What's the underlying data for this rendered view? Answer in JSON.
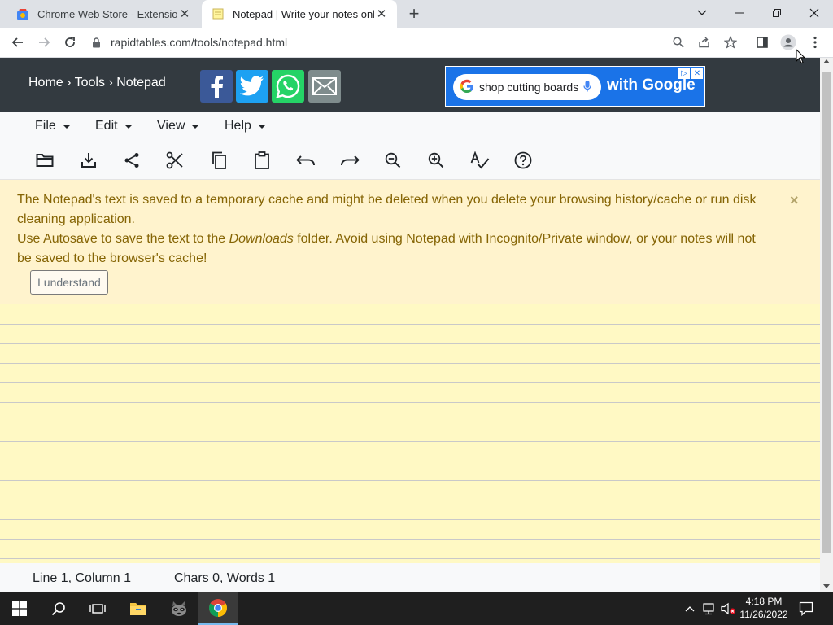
{
  "browser": {
    "tabs": [
      {
        "title": "Chrome Web Store - Extensions",
        "active": false
      },
      {
        "title": "Notepad | Write your notes online",
        "active": true
      }
    ],
    "url": "rapidtables.com/tools/notepad.html"
  },
  "header": {
    "breadcrumb": [
      "Home",
      "Tools",
      "Notepad"
    ],
    "breadcrumb_sep": "›",
    "share": [
      "facebook-icon",
      "twitter-icon",
      "whatsapp-icon",
      "email-icon"
    ],
    "share_colors": {
      "facebook": "#3b5998",
      "twitter": "#1da1f2",
      "whatsapp": "#25d366",
      "email": "#7f8c8d"
    }
  },
  "ad": {
    "query": "shop cutting boards",
    "tagline": "with Google"
  },
  "menu": {
    "items": [
      "File",
      "Edit",
      "View",
      "Help"
    ]
  },
  "toolbar": {
    "tools": [
      "open-icon",
      "download-icon",
      "share-icon",
      "cut-icon",
      "copy-icon",
      "paste-icon",
      "undo-icon",
      "redo-icon",
      "zoom-out-icon",
      "zoom-in-icon",
      "spellcheck-icon",
      "help-icon"
    ]
  },
  "alert": {
    "line1": "The Notepad's text is saved to a temporary cache and might be deleted when you delete your browsing history/cache or run disk cleaning application.",
    "line2_before": "Use Autosave to save the text to the ",
    "line2_em": "Downloads",
    "line2_after": " folder. Avoid using Notepad with Incognito/Private window, or your notes will not be saved to the browser's cache!",
    "button": "I understand",
    "close": "×"
  },
  "editor": {
    "content": ""
  },
  "status": {
    "position": "Line 1, Column 1",
    "counts": "Chars 0, Words 1"
  },
  "taskbar": {
    "time": "4:18 PM",
    "date": "11/26/2022"
  },
  "colors": {
    "header_bg": "#333a40",
    "alert_bg": "#fff3cd",
    "alert_text": "#856404",
    "paper": "#fff9c4",
    "ad_bg": "#1a73e8"
  }
}
